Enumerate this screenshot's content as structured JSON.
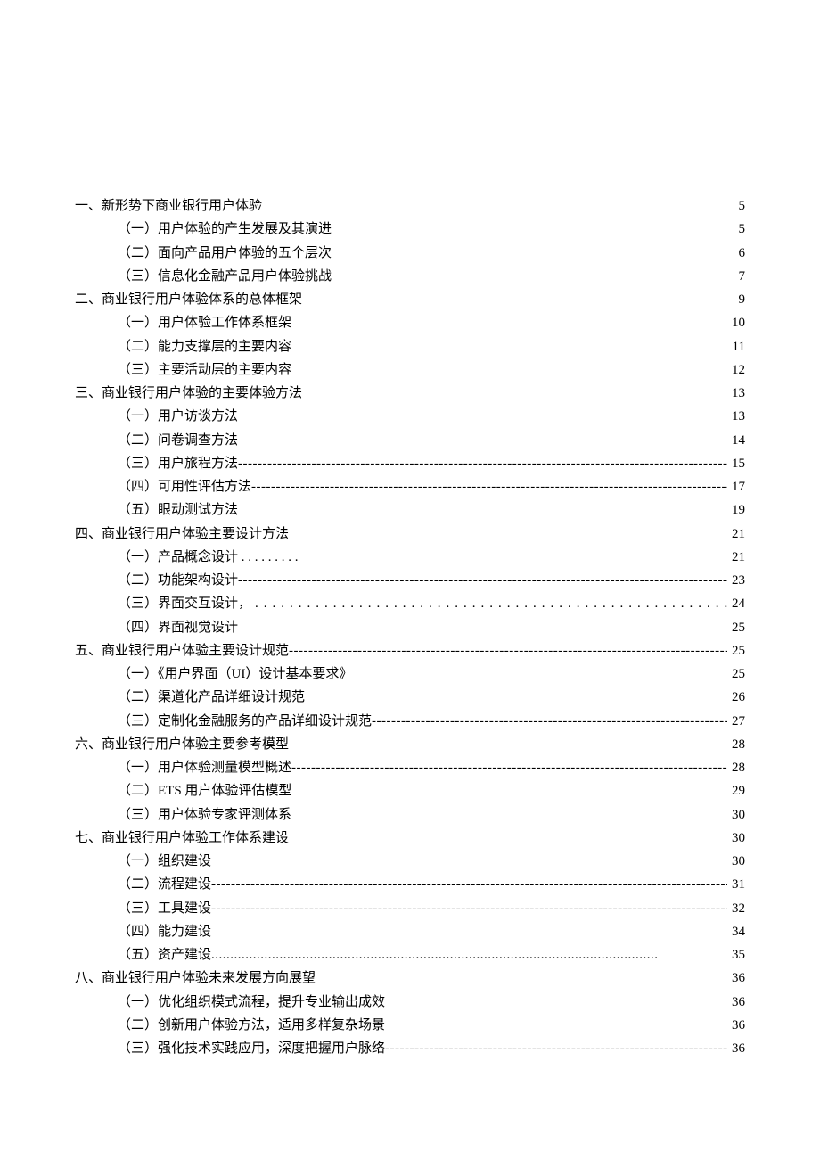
{
  "toc": [
    {
      "t": "一、新形势下商业银行用户体验",
      "p": "5",
      "lvl": 0,
      "ld": "none"
    },
    {
      "t": "（一）用户体验的产生发展及其演进",
      "p": "5",
      "lvl": 1,
      "ld": "none"
    },
    {
      "t": "（二）面向产品用户体验的五个层次",
      "p": "6",
      "lvl": 1,
      "ld": "none"
    },
    {
      "t": "（三）信息化金融产品用户体验挑战",
      "p": "7",
      "lvl": 1,
      "ld": "none"
    },
    {
      "t": "二、商业银行用户体验体系的总体框架",
      "p": "9",
      "lvl": 0,
      "ld": "none"
    },
    {
      "t": "（一）用户体验工作体系框架",
      "p": "10",
      "lvl": 1,
      "ld": "none"
    },
    {
      "t": "（二）能力支撑层的主要内容",
      "p": "11",
      "lvl": 1,
      "ld": "none"
    },
    {
      "t": "（三）主要活动层的主要内容",
      "p": "12",
      "lvl": 1,
      "ld": "none"
    },
    {
      "t": "三、商业银行用户体验的主要体验方法",
      "p": "13",
      "lvl": 0,
      "ld": "none"
    },
    {
      "t": "（一）用户访谈方法",
      "p": "13",
      "lvl": 1,
      "ld": "none"
    },
    {
      "t": "（二）问卷调查方法",
      "p": "14",
      "lvl": 1,
      "ld": "none"
    },
    {
      "t": "（三）用户旅程方法",
      "p": "15",
      "lvl": 1,
      "ld": "dash"
    },
    {
      "t": "（四）可用性评估方法",
      "p": "17",
      "lvl": 1,
      "ld": "dash"
    },
    {
      "t": "（五）眼动测试方法",
      "p": "19",
      "lvl": 1,
      "ld": "none"
    },
    {
      "t": "四、商业银行用户体验主要设计方法",
      "p": "21",
      "lvl": 0,
      "ld": "none"
    },
    {
      "t": "（一）产品概念设计 . . . . . . . . .",
      "p": "21",
      "lvl": 1,
      "ld": "none"
    },
    {
      "t": "（二）功能架构设计",
      "p": "23",
      "lvl": 1,
      "ld": "dash"
    },
    {
      "t": "（三）界面交互设计，",
      "p": "24",
      "lvl": 1,
      "ld": "dot2"
    },
    {
      "t": "（四）界面视觉设计",
      "p": "25",
      "lvl": 1,
      "ld": "none"
    },
    {
      "t": "五、商业银行用户体验主要设计规范 ",
      "p": "25",
      "lvl": 0,
      "ld": "dash"
    },
    {
      "t": "（一）《用户界面（UI）设计基本要求》",
      "p": "25",
      "lvl": 1,
      "ld": "none"
    },
    {
      "t": "（二）渠道化产品详细设计规范",
      "p": "26",
      "lvl": 1,
      "ld": "none"
    },
    {
      "t": "（三）定制化金融服务的产品详细设计规范",
      "p": "27",
      "lvl": 1,
      "ld": "dash"
    },
    {
      "t": "六、商业银行用户体验主要参考模型",
      "p": "28",
      "lvl": 0,
      "ld": "none"
    },
    {
      "t": "（一）用户体验测量模型概述",
      "p": "28",
      "lvl": 1,
      "ld": "dash"
    },
    {
      "t": "（二）ETS 用户体验评估模型",
      "p": "29",
      "lvl": 1,
      "ld": "none"
    },
    {
      "t": "（三）用户体验专家评测体系",
      "p": "30",
      "lvl": 1,
      "ld": "none"
    },
    {
      "t": "七、商业银行用户体验工作体系建设",
      "p": "30",
      "lvl": 0,
      "ld": "none"
    },
    {
      "t": "（一）组织建设",
      "p": "30",
      "lvl": 1,
      "ld": "none"
    },
    {
      "t": "（二）流程建设",
      "p": "31",
      "lvl": 1,
      "ld": "dash"
    },
    {
      "t": "（三）工具建设",
      "p": "32",
      "lvl": 1,
      "ld": "dash"
    },
    {
      "t": "（四）能力建设",
      "p": "34",
      "lvl": 1,
      "ld": "none"
    },
    {
      "t": "（五）资产建设",
      "p": "35",
      "lvl": 1,
      "ld": "dot1"
    },
    {
      "t": "八、商业银行用户体验未来发展方向展望",
      "p": "36",
      "lvl": 0,
      "ld": "none"
    },
    {
      "t": "（一）优化组织模式流程，提升专业输出成效",
      "p": "36",
      "lvl": 1,
      "ld": "none"
    },
    {
      "t": "（二）创新用户体验方法，适用多样复杂场景",
      "p": "36",
      "lvl": 1,
      "ld": "none"
    },
    {
      "t": "（三）强化技术实践应用，深度把握用户脉络",
      "p": "36",
      "lvl": 1,
      "ld": "dash"
    }
  ]
}
